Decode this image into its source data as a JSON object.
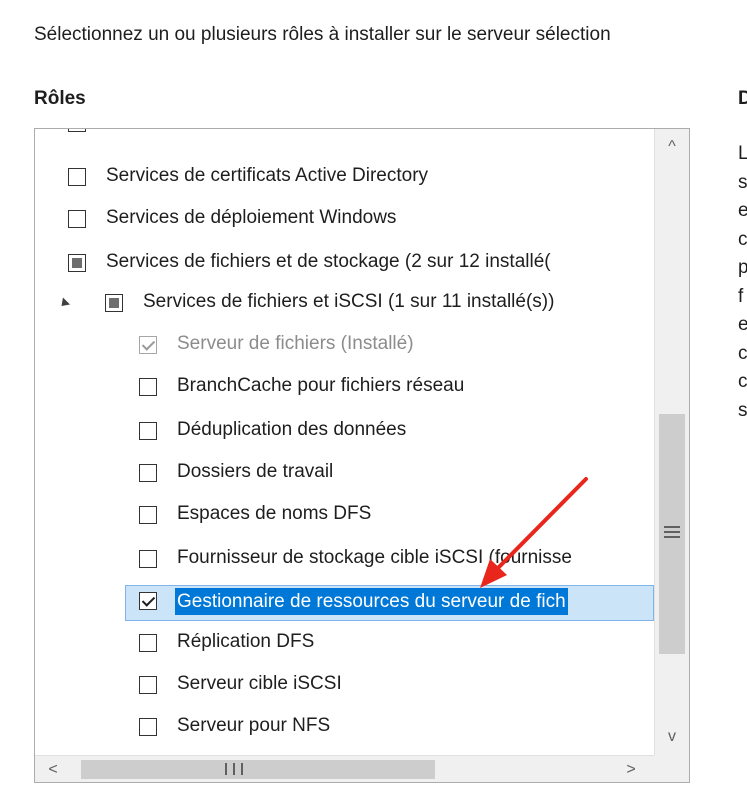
{
  "instruction": "Sélectionnez un ou plusieurs rôles à installer sur le serveur sélection",
  "roles_heading": "Rôles",
  "description_heading": "D",
  "description_fragments": [
    "L",
    "s",
    "e",
    "c",
    "p",
    "f",
    "e",
    "c",
    "c",
    "s"
  ],
  "roles": [
    {
      "label": "",
      "checkbox": "unchecked",
      "partial_row": true
    },
    {
      "label": "Services de certificats Active Directory",
      "checkbox": "unchecked"
    },
    {
      "label": "Services de déploiement Windows",
      "checkbox": "unchecked"
    },
    {
      "label": "Services de fichiers et de stockage (2 sur 12 installé(",
      "checkbox": "partial"
    },
    {
      "label": "Services de fichiers et iSCSI (1 sur 11 installé(s))",
      "checkbox": "partial",
      "expanded": true
    },
    {
      "label": "Serveur de fichiers (Installé)",
      "checkbox": "checked",
      "disabled": true
    },
    {
      "label": "BranchCache pour fichiers réseau",
      "checkbox": "unchecked"
    },
    {
      "label": "Déduplication des données",
      "checkbox": "unchecked"
    },
    {
      "label": "Dossiers de travail",
      "checkbox": "unchecked"
    },
    {
      "label": "Espaces de noms DFS",
      "checkbox": "unchecked"
    },
    {
      "label": "Fournisseur de stockage cible iSCSI (fournisse",
      "checkbox": "unchecked"
    },
    {
      "label": "Gestionnaire de ressources du serveur de fich",
      "checkbox": "checked",
      "selected": true
    },
    {
      "label": "Réplication DFS",
      "checkbox": "unchecked"
    },
    {
      "label": "Serveur cible iSCSI",
      "checkbox": "unchecked"
    },
    {
      "label": "Serveur pour NFS",
      "checkbox": "unchecked"
    }
  ],
  "scrollbar": {
    "up_arrow": "^",
    "down_arrow": "v",
    "left_arrow": "<",
    "right_arrow": ">"
  },
  "colors": {
    "selection_fill": "#0078d7",
    "selection_row": "#cce4f7",
    "annotation_arrow": "#e8261c"
  }
}
